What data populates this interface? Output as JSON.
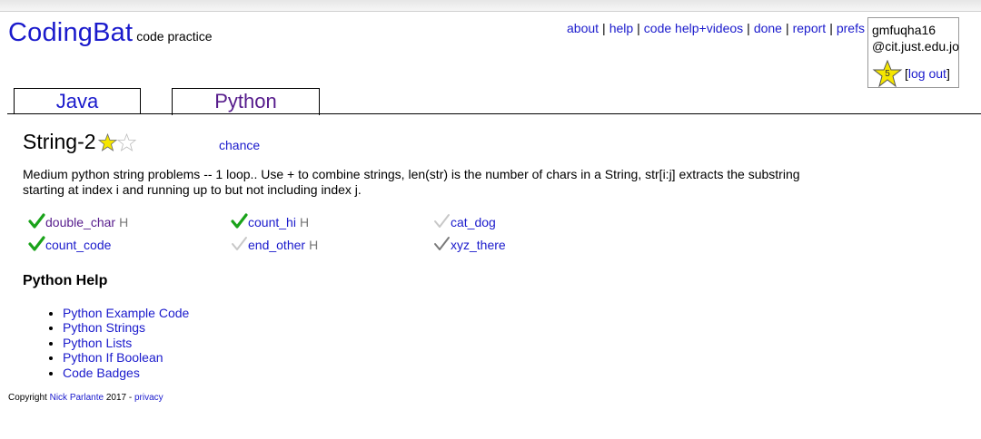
{
  "header": {
    "logo": "CodingBat",
    "tagline": "code practice",
    "nav": [
      {
        "label": "about"
      },
      {
        "label": "help"
      },
      {
        "label": "code help+videos"
      },
      {
        "label": "done"
      },
      {
        "label": "report"
      },
      {
        "label": "prefs"
      }
    ],
    "separator": "|"
  },
  "user": {
    "name": "gmfuqha16",
    "domain": "@cit.just.edu.jo",
    "badge_count": "5",
    "logout_open": "[",
    "logout_label": "log out",
    "logout_close": "]"
  },
  "tabs": [
    {
      "label": "Java",
      "active": false
    },
    {
      "label": "Python",
      "active": true
    }
  ],
  "section": {
    "title": "String-2",
    "difficulty_stars_filled": 1,
    "difficulty_stars_total": 2,
    "chance_label": "chance",
    "description": "Medium python string problems -- 1 loop.. Use + to combine strings, len(str) is the number of chars in a String, str[i:j] extracts the substring starting at index i and running up to but not including index j."
  },
  "problems": [
    {
      "name": "double_char",
      "status": "solved",
      "hint": "H"
    },
    {
      "name": "count_hi",
      "status": "solved",
      "hint": "H"
    },
    {
      "name": "cat_dog",
      "status": "unsolved",
      "hint": ""
    },
    {
      "name": "count_code",
      "status": "solved",
      "hint": ""
    },
    {
      "name": "end_other",
      "status": "unsolved",
      "hint": "H"
    },
    {
      "name": "xyz_there",
      "status": "attempted",
      "hint": ""
    }
  ],
  "help": {
    "title": "Python Help",
    "links": [
      "Python Example Code",
      "Python Strings",
      "Python Lists",
      "Python If Boolean",
      "Code Badges"
    ]
  },
  "footer": {
    "copyright": "Copyright",
    "author": "Nick Parlante",
    "year_sep": "2017 -",
    "privacy": "privacy"
  },
  "colors": {
    "link": "#1a1acc",
    "visited": "#551a8b",
    "check_solved": "#1aa31a",
    "check_unsolved": "#c8c8c8",
    "check_attempted": "#7a7a7a",
    "star": "#f5e600"
  }
}
